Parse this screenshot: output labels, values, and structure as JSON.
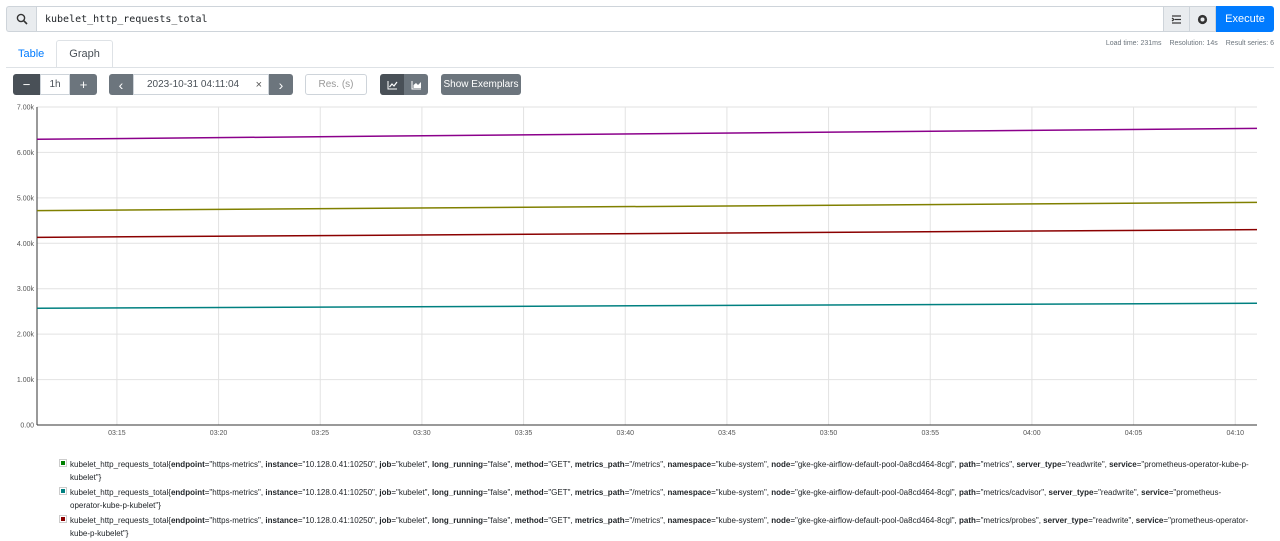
{
  "query": {
    "value": "kubelet_http_requests_total",
    "execute_label": "Execute"
  },
  "tabs": [
    {
      "label": "Table"
    },
    {
      "label": "Graph"
    }
  ],
  "stats": {
    "load_time": "Load time: 231ms",
    "resolution": "Resolution: 14s",
    "result_series": "Result series: 6"
  },
  "controls": {
    "range": "1h",
    "end_time": "2023-10-31 04:11:04",
    "clear": "×",
    "res_placeholder": "Res. (s)",
    "exemplars_label": "Show Exemplars",
    "minus": "−",
    "plus": "+",
    "prev": "‹",
    "next": "›"
  },
  "icons": {
    "search": "search-icon",
    "format": "format-icon",
    "metrics_explorer": "metrics-explorer-icon",
    "line_chart": "line-chart-icon",
    "stacked_chart": "stacked-chart-icon"
  },
  "chart_data": {
    "type": "line",
    "ylim": [
      0,
      7000
    ],
    "y_ticks": [
      0,
      1000,
      2000,
      3000,
      4000,
      5000,
      6000,
      7000
    ],
    "y_tick_labels": [
      "0.00",
      "1.00k",
      "2.00k",
      "3.00k",
      "4.00k",
      "5.00k",
      "6.00k",
      "7.00k"
    ],
    "x_ticks": [
      15,
      20,
      25,
      30,
      35,
      40,
      45,
      50,
      55,
      60,
      65,
      70
    ],
    "x_tick_labels": [
      "03:15",
      "03:20",
      "03:25",
      "03:30",
      "03:35",
      "03:40",
      "03:45",
      "03:50",
      "03:55",
      "04:00",
      "04:05",
      "04:10"
    ],
    "xlim": [
      11.07,
      71.07
    ],
    "series": [
      {
        "color": "#8b008b",
        "x": [
          11.07,
          71.07
        ],
        "y": [
          6290,
          6530
        ]
      },
      {
        "color": "#808000",
        "x": [
          11.07,
          71.07
        ],
        "y": [
          4720,
          4900
        ]
      },
      {
        "color": "#8b0000",
        "x": [
          11.07,
          71.07
        ],
        "y": [
          4130,
          4300
        ]
      },
      {
        "color": "#008080",
        "x": [
          11.07,
          71.07
        ],
        "y": [
          2570,
          2680
        ]
      }
    ]
  },
  "legend": [
    {
      "color": "#008000",
      "metric": "kubelet_http_requests_total{",
      "labels": [
        [
          "endpoint",
          "\"https-metrics\", "
        ],
        [
          "instance",
          "\"10.128.0.41:10250\", "
        ],
        [
          "job",
          "\"kubelet\", "
        ],
        [
          "long_running",
          "\"false\", "
        ],
        [
          "method",
          "\"GET\", "
        ],
        [
          "metrics_path",
          "\"/metrics\", "
        ],
        [
          "namespace",
          "\"kube-system\", "
        ],
        [
          "node",
          "\"gke-gke-airflow-default-pool-0a8cd464-8cgl\", "
        ],
        [
          "path",
          "\"metrics\", "
        ],
        [
          "server_type",
          "\"readwrite\", "
        ],
        [
          "service",
          "\"prometheus-operator-kube-p-kubelet\"}"
        ]
      ]
    },
    {
      "color": "#008080",
      "metric": "kubelet_http_requests_total{",
      "labels": [
        [
          "endpoint",
          "\"https-metrics\", "
        ],
        [
          "instance",
          "\"10.128.0.41:10250\", "
        ],
        [
          "job",
          "\"kubelet\", "
        ],
        [
          "long_running",
          "\"false\", "
        ],
        [
          "method",
          "\"GET\", "
        ],
        [
          "metrics_path",
          "\"/metrics\", "
        ],
        [
          "namespace",
          "\"kube-system\", "
        ],
        [
          "node",
          "\"gke-gke-airflow-default-pool-0a8cd464-8cgl\", "
        ],
        [
          "path",
          "\"metrics/cadvisor\", "
        ],
        [
          "server_type",
          "\"readwrite\", "
        ],
        [
          "service",
          "\"prometheus-operator-kube-p-kubelet\"}"
        ]
      ]
    },
    {
      "color": "#8b0000",
      "metric": "kubelet_http_requests_total{",
      "labels": [
        [
          "endpoint",
          "\"https-metrics\", "
        ],
        [
          "instance",
          "\"10.128.0.41:10250\", "
        ],
        [
          "job",
          "\"kubelet\", "
        ],
        [
          "long_running",
          "\"false\", "
        ],
        [
          "method",
          "\"GET\", "
        ],
        [
          "metrics_path",
          "\"/metrics\", "
        ],
        [
          "namespace",
          "\"kube-system\", "
        ],
        [
          "node",
          "\"gke-gke-airflow-default-pool-0a8cd464-8cgl\", "
        ],
        [
          "path",
          "\"metrics/probes\", "
        ],
        [
          "server_type",
          "\"readwrite\", "
        ],
        [
          "service",
          "\"prometheus-operator-kube-p-kubelet\"}"
        ]
      ]
    }
  ]
}
